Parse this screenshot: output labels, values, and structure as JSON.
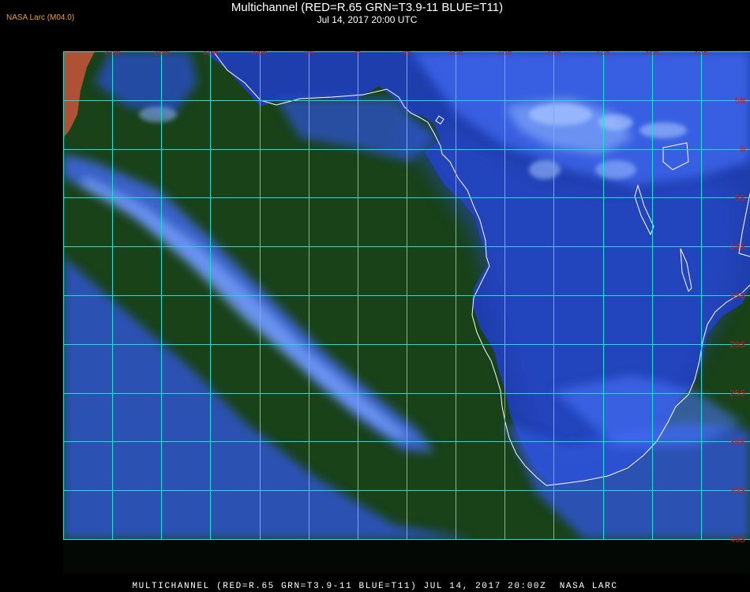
{
  "header": {
    "brand": "NASA Larc (M04.0)",
    "title": "Multichannel (RED=R.65 GRN=T3.9-11 BLUE=T11)",
    "subtitle": "Jul 14, 2017 20:00 UTC"
  },
  "footer": {
    "caption": "MULTICHANNEL (RED=R.65 GRN=T3.9-11 BLUE=T11) JUL 14, 2017 20:00Z  NASA LARC"
  },
  "map": {
    "lon_range": [
      -30,
      40
    ],
    "lat_range": [
      10,
      -40
    ],
    "grid_step_deg": 5,
    "longitude_labels": [
      "25W",
      "20W",
      "15W",
      "10W",
      "5W",
      "0",
      "5E",
      "10E",
      "15E",
      "20E",
      "25E",
      "30E",
      "35E"
    ],
    "latitude_labels": [
      "5N",
      "0",
      "5S",
      "10S",
      "15S",
      "20S",
      "25S",
      "30S",
      "35S",
      "40S"
    ],
    "colors": {
      "grid": "#19e0d8",
      "label": "#c81e1e",
      "coastline": "#ffffff",
      "ocean": "#163a16",
      "land": "#1e3faa",
      "cloud": "#4a78ff",
      "high_cloud": "#9fc3ff"
    }
  }
}
